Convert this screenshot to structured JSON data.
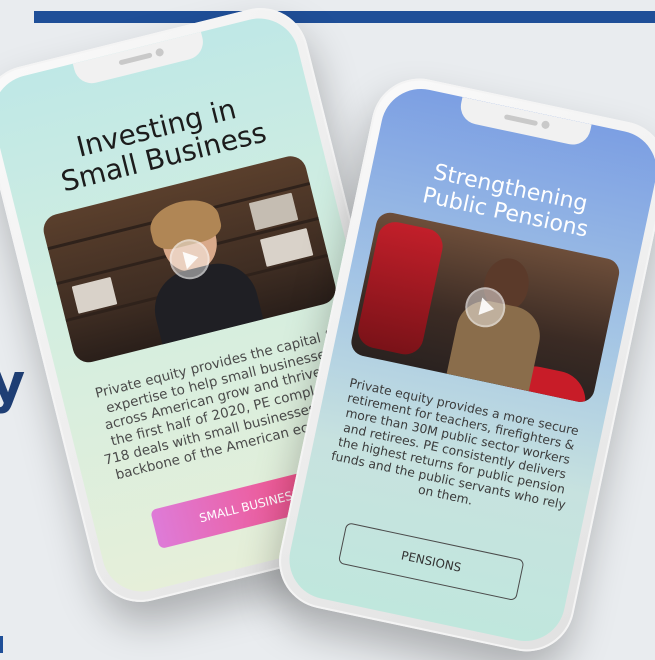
{
  "phone_small_business": {
    "title_line1": "Investing in",
    "title_line2": "Small Business",
    "body": "Private equity provides the capital & expertise to help small businesses across American grow and thrive. In the first half of 2020, PE completed 718 deals with small businesses — the backbone of the American economy.",
    "button_label": "SMALL BUSINESS"
  },
  "phone_pensions": {
    "title_line1": "Strengthening",
    "title_line2": "Public Pensions",
    "body": "Private equity provides a more secure retirement for teachers, firefighters & more than 30M public sector workers and retirees. PE consistently delivers the highest returns for public pension funds and the public servants who rely on them.",
    "button_label": "PENSIONS"
  },
  "colors": {
    "top_bar": "#1f4f98",
    "small_business_button": "#f74b78",
    "pensions_title": "#ffffff"
  }
}
